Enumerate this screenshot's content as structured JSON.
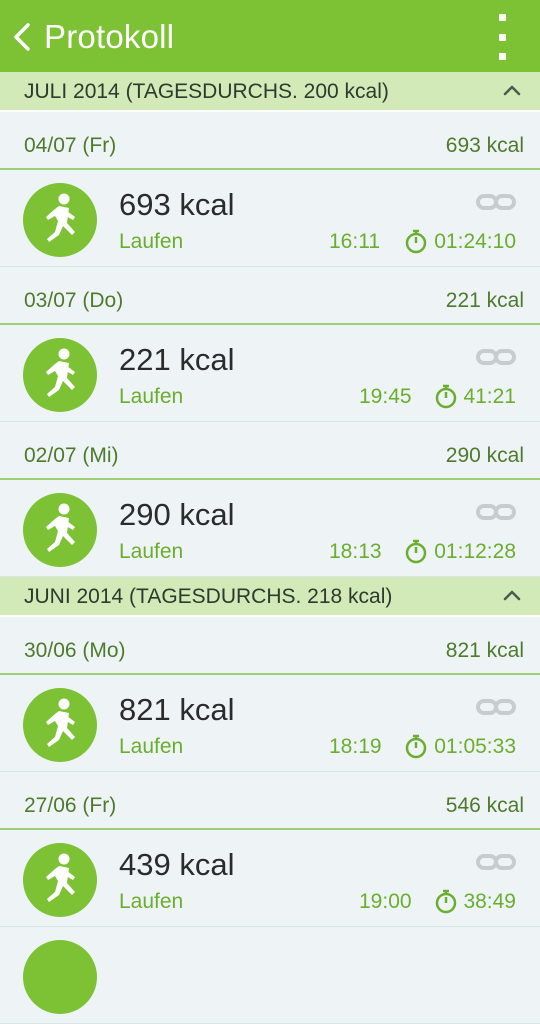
{
  "header": {
    "title": "Protokoll",
    "back_icon": "chevron-left-icon",
    "menu_icon": "more-vertical-icon"
  },
  "colors": {
    "bar": "#7dc135",
    "month_bg": "#d2e9b8",
    "accent_text": "#6bad2f"
  },
  "months": [
    {
      "label": "JULI 2014 (TAGESDURCHS. 200 kcal)"
    },
    {
      "label": "JUNI 2014 (TAGESDURCHS. 218 kcal)"
    }
  ],
  "days": [
    {
      "date": "04/07 (Fr)",
      "total": "693 kcal"
    },
    {
      "date": "03/07 (Do)",
      "total": "221 kcal"
    },
    {
      "date": "02/07 (Mi)",
      "total": "290 kcal"
    },
    {
      "date": "30/06 (Mo)",
      "total": "821 kcal"
    },
    {
      "date": "27/06 (Fr)",
      "total": "546 kcal"
    }
  ],
  "entries": [
    {
      "kcal": "693 kcal",
      "activity": "Laufen",
      "time": "16:11",
      "duration": "01:24:10"
    },
    {
      "kcal": "221 kcal",
      "activity": "Laufen",
      "time": "19:45",
      "duration": "41:21"
    },
    {
      "kcal": "290 kcal",
      "activity": "Laufen",
      "time": "18:13",
      "duration": "01:12:28"
    },
    {
      "kcal": "821 kcal",
      "activity": "Laufen",
      "time": "18:19",
      "duration": "01:05:33"
    },
    {
      "kcal": "439 kcal",
      "activity": "Laufen",
      "time": "19:00",
      "duration": "38:49"
    }
  ]
}
